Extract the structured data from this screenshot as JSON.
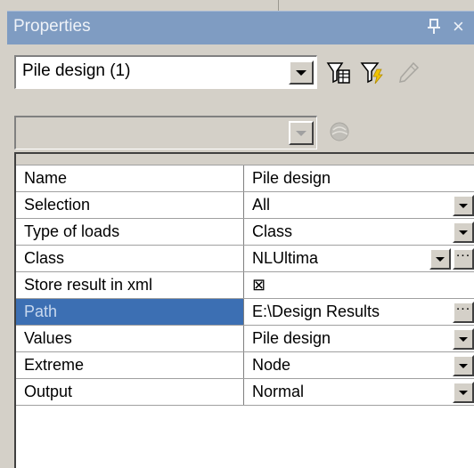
{
  "panel": {
    "title": "Properties",
    "close_glyph": "×"
  },
  "selector": {
    "value": "Pile design (1)",
    "secondary_value": ""
  },
  "toolbar": {
    "filter_icon": "filter-table-icon",
    "filter_lightning_icon": "filter-lightning-icon",
    "edit_icon": "pencil-icon",
    "disabled_icon": "sphere-icon"
  },
  "properties": [
    {
      "name": "Name",
      "value": "Pile design",
      "dropdown": false,
      "ellipsis": false,
      "selected": false
    },
    {
      "name": "Selection",
      "value": "All",
      "dropdown": true,
      "ellipsis": false,
      "selected": false
    },
    {
      "name": "Type of loads",
      "value": "Class",
      "dropdown": true,
      "ellipsis": false,
      "selected": false
    },
    {
      "name": "Class",
      "value": "NLUltima",
      "dropdown": true,
      "ellipsis": true,
      "selected": false
    },
    {
      "name": "Store result in xml",
      "value": "⊠",
      "dropdown": false,
      "ellipsis": false,
      "selected": false
    },
    {
      "name": "Path",
      "value": "E:\\Design Results",
      "dropdown": false,
      "ellipsis": true,
      "selected": true
    },
    {
      "name": "Values",
      "value": "Pile design",
      "dropdown": true,
      "ellipsis": false,
      "selected": false
    },
    {
      "name": "Extreme",
      "value": "Node",
      "dropdown": true,
      "ellipsis": false,
      "selected": false
    },
    {
      "name": "Output",
      "value": "Normal",
      "dropdown": true,
      "ellipsis": false,
      "selected": false
    }
  ],
  "colors": {
    "titlebar": "#7f9cc2",
    "selected_row": "#3c6fb3",
    "panel_bg": "#d4d0c8"
  }
}
